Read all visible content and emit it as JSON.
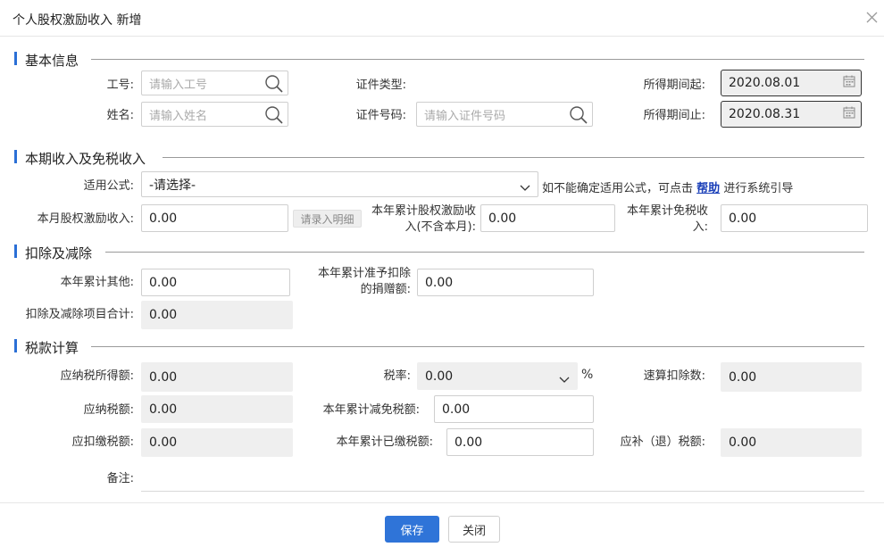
{
  "dialog": {
    "title": "个人股权激励收入 新增"
  },
  "sections": {
    "basic": "基本信息",
    "income": "本期收入及免税收入",
    "deduction": "扣除及减除",
    "tax": "税款计算"
  },
  "basic": {
    "employee_id_label": "工号:",
    "employee_id_placeholder": "请输入工号",
    "name_label": "姓名:",
    "name_placeholder": "请输入姓名",
    "id_type_label": "证件类型:",
    "id_number_label": "证件号码:",
    "id_number_placeholder": "请输入证件号码",
    "period_start_label": "所得期间起:",
    "period_start_value": "2020.08.01",
    "period_end_label": "所得期间止:",
    "period_end_value": "2020.08.31"
  },
  "income": {
    "formula_label": "适用公式:",
    "formula_value": "-请选择-",
    "formula_hint_pre": "如不能确定适用公式，可点击",
    "help_link": "帮助",
    "formula_hint_post": "进行系统引导",
    "monthly_label": "本月股权激励收入:",
    "monthly_value": "0.00",
    "detail_button": "请录入明细",
    "ytd_income_label": "本年累计股权激励收入(不含本月):",
    "ytd_income_value": "0.00",
    "ytd_exempt_label": "本年累计免税收入:",
    "ytd_exempt_value": "0.00"
  },
  "deduction": {
    "ytd_other_label": "本年累计其他:",
    "ytd_other_value": "0.00",
    "ytd_donation_label": "本年累计准予扣除的捐赠额:",
    "ytd_donation_value": "0.00",
    "total_label": "扣除及减除项目合计:",
    "total_value": "0.00"
  },
  "tax": {
    "taxable_income_label": "应纳税所得额:",
    "taxable_income_value": "0.00",
    "rate_label": "税率:",
    "rate_value": "0.00",
    "rate_unit": "%",
    "quick_deduction_label": "速算扣除数:",
    "quick_deduction_value": "0.00",
    "tax_payable_label": "应纳税额:",
    "tax_payable_value": "0.00",
    "ytd_reduction_label": "本年累计减免税额:",
    "ytd_reduction_value": "0.00",
    "withheld_label": "应扣缴税额:",
    "withheld_value": "0.00",
    "ytd_paid_label": "本年累计已缴税额:",
    "ytd_paid_value": "0.00",
    "refund_label": "应补（退）税额:",
    "refund_value": "0.00",
    "remark_label": "备注:"
  },
  "footer": {
    "save": "保存",
    "close": "关闭"
  },
  "colors": {
    "primary": "#2f74d8",
    "section_accent": "#2b6fd6",
    "readonly_bg": "#efefef"
  }
}
